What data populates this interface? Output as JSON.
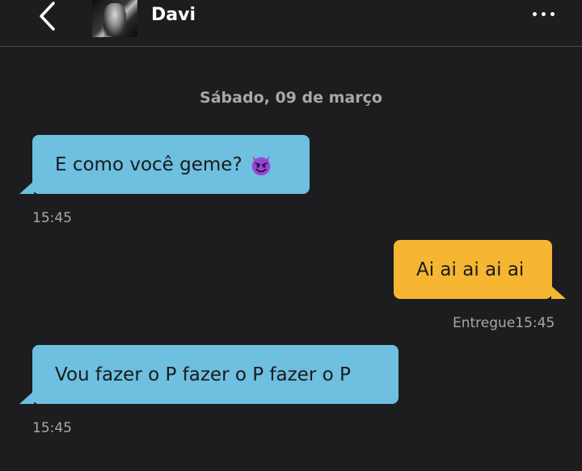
{
  "header": {
    "contact_name": "Davi",
    "back_icon": "chevron-left-icon",
    "more_icon": "more-horizontal-icon"
  },
  "date_separator": "Sábado, 09 de março",
  "messages": [
    {
      "direction": "incoming",
      "text": "E como você geme?",
      "emoji": "smiling-devil-emoji",
      "time": "15:45"
    },
    {
      "direction": "outgoing",
      "text": "Ai ai ai ai ai",
      "status": "Entregue",
      "time": "15:45"
    },
    {
      "direction": "incoming",
      "text": "Vou fazer o P fazer o P fazer o P",
      "time": "15:45"
    }
  ],
  "colors": {
    "background": "#1d1d1f",
    "incoming_bubble": "#6ebfe0",
    "outgoing_bubble": "#f6b632",
    "muted_text": "#a8a8ab"
  }
}
